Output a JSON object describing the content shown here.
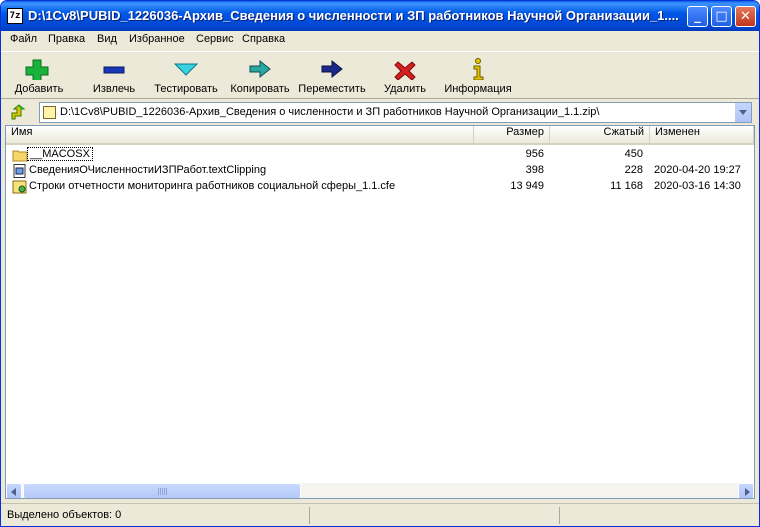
{
  "window": {
    "title": "D:\\1Cv8\\PUBID_1226036-Архив_Сведения о численности и ЗП работников Научной Организации_1....",
    "app_icon_text": "7z"
  },
  "menu": [
    "Файл",
    "Правка",
    "Вид",
    "Избранное",
    "Сервис",
    "Справка"
  ],
  "toolbar": [
    {
      "label": "Добавить",
      "icon": "plus-icon"
    },
    {
      "label": "Извлечь",
      "icon": "minus-icon"
    },
    {
      "label": "Тестировать",
      "icon": "check-icon"
    },
    {
      "label": "Копировать",
      "icon": "copy-arrow-icon"
    },
    {
      "label": "Переместить",
      "icon": "move-arrow-icon"
    },
    {
      "label": "Удалить",
      "icon": "delete-x-icon"
    },
    {
      "label": "Информация",
      "icon": "info-icon"
    }
  ],
  "address": {
    "path": "D:\\1Cv8\\PUBID_1226036-Архив_Сведения о численности и ЗП работников Научной Организации_1.1.zip\\"
  },
  "columns": {
    "name": "Имя",
    "size": "Размер",
    "packed": "Сжатый",
    "modified": "Изменен"
  },
  "files": [
    {
      "name": "__MACOSX",
      "size": "956",
      "packed": "450",
      "modified": "",
      "icon": "folder-icon"
    },
    {
      "name": "СведенияОЧисленностиИЗПРабот.textClipping",
      "size": "398",
      "packed": "228",
      "modified": "2020-04-20 19:27",
      "icon": "document-icon"
    },
    {
      "name": "Строки отчетности мониторинга работников социальной сферы_1.1.cfe",
      "size": "13 949",
      "packed": "11 168",
      "modified": "2020-03-16 14:30",
      "icon": "config-file-icon"
    }
  ],
  "status": {
    "selected": "Выделено объектов: 0"
  },
  "colors": {
    "titlebar": "#0058e6",
    "chrome": "#ece9d8",
    "add_icon": "#19b23a",
    "extract_icon": "#1836b5",
    "test_icon": "#3ad2e0",
    "delete_icon": "#d42020"
  }
}
